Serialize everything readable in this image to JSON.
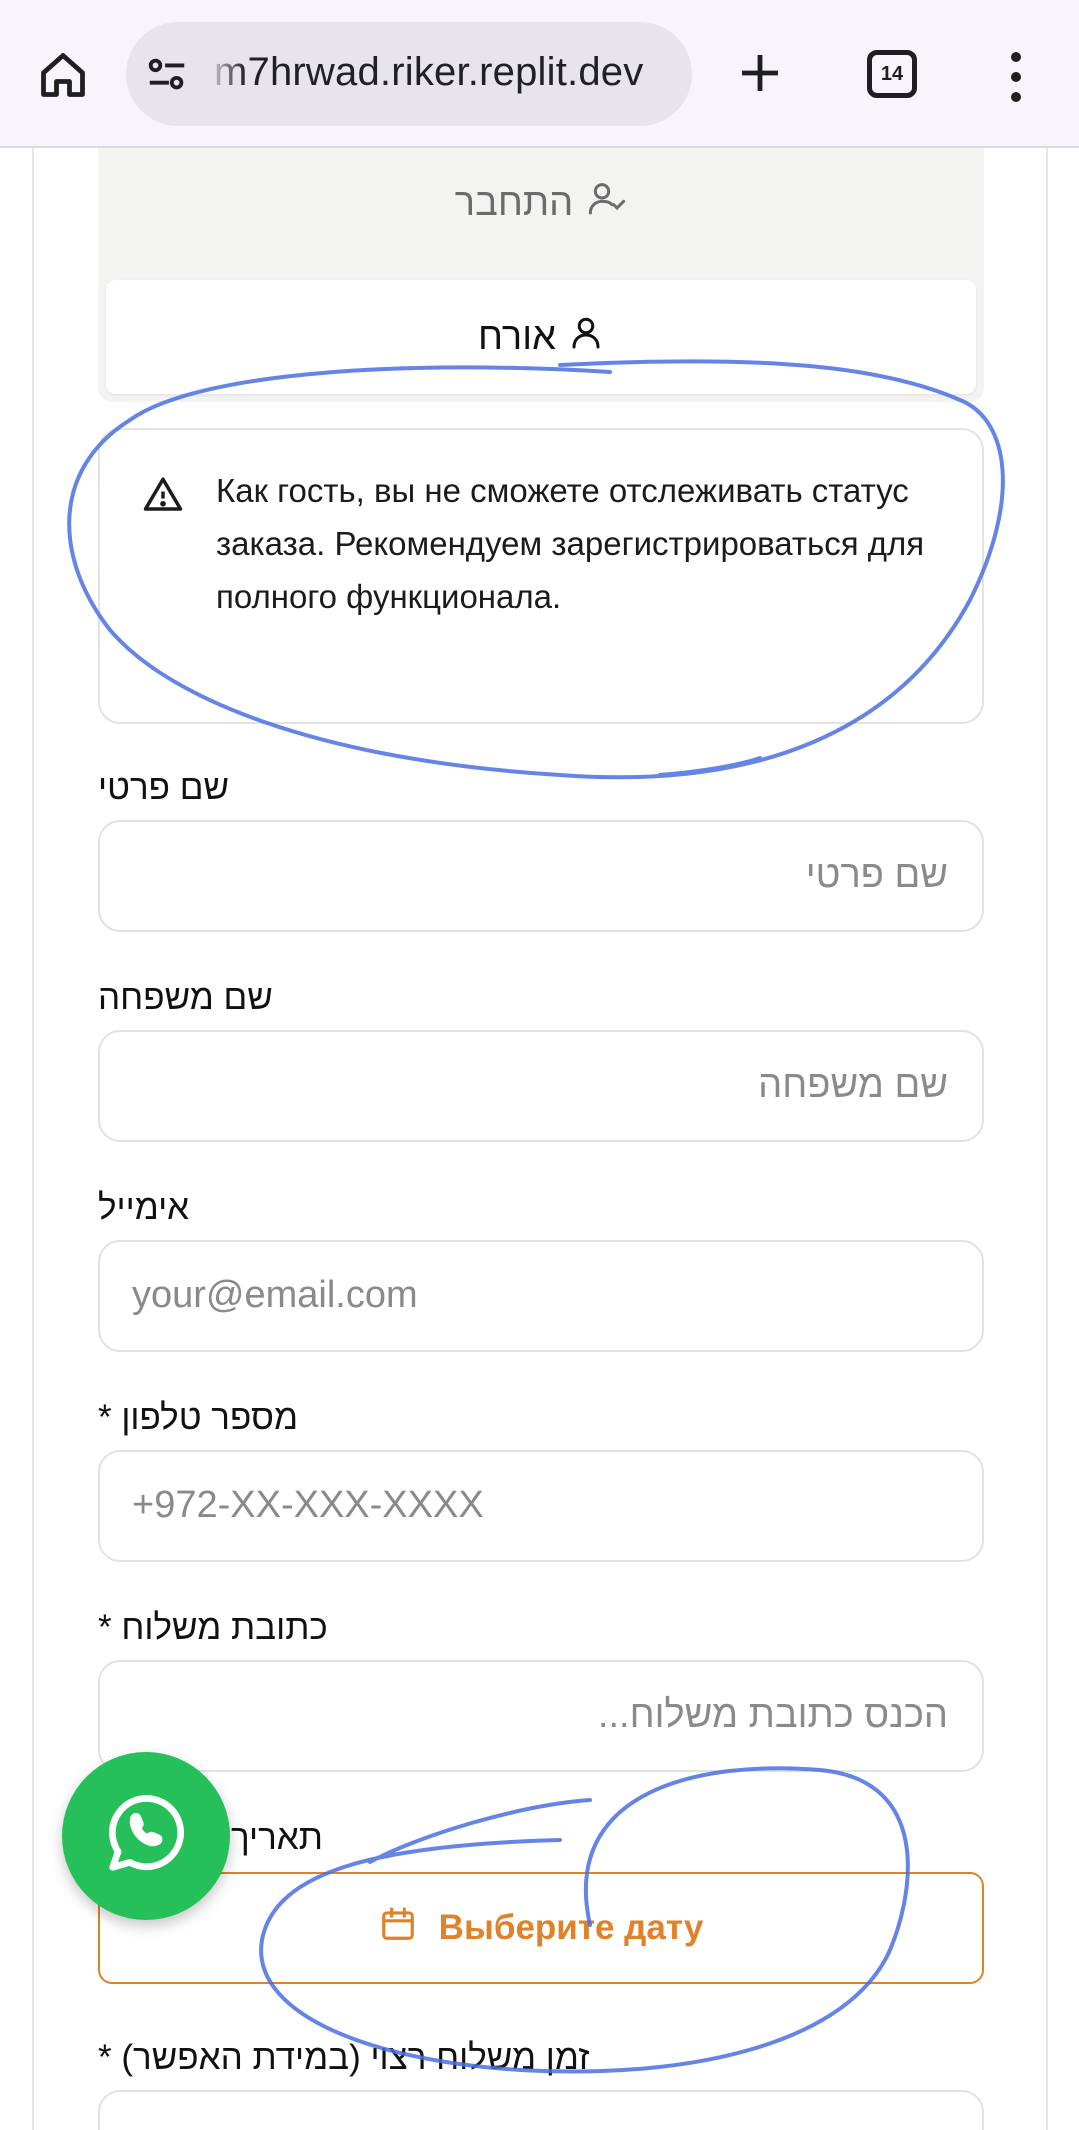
{
  "browser": {
    "url": "m7hrwad.riker.replit.dev",
    "tab_count": "14"
  },
  "auth_tabs": {
    "login_label": "התחבר",
    "guest_label": "אורח"
  },
  "guest_alert": {
    "text": "Как гость, вы не сможете отслеживать статус заказа. Рекомендуем зарегистрироваться для полного функционала."
  },
  "form": {
    "first_name": {
      "label": "שם פרטי",
      "placeholder": "שם פרטי"
    },
    "last_name": {
      "label": "שם משפחה",
      "placeholder": "שם משפחה"
    },
    "email": {
      "label": "אימייל",
      "placeholder": "your@email.com"
    },
    "phone": {
      "label": "מספר טלפון *",
      "placeholder": "+972-XX-XXX-XXXX"
    },
    "address": {
      "label": "כתובת משלוח *",
      "placeholder": "הכנס כתובת משלוח..."
    },
    "date": {
      "label": "תאריך משלוח *",
      "button_label": "Выберите дату"
    },
    "time": {
      "label": "זמן משלוח רצוי (במידת האפשר) *"
    }
  },
  "colors": {
    "accent_orange": "#e0822a",
    "whatsapp_green": "#25c05a",
    "annotation_blue": "#4a6fe0"
  }
}
